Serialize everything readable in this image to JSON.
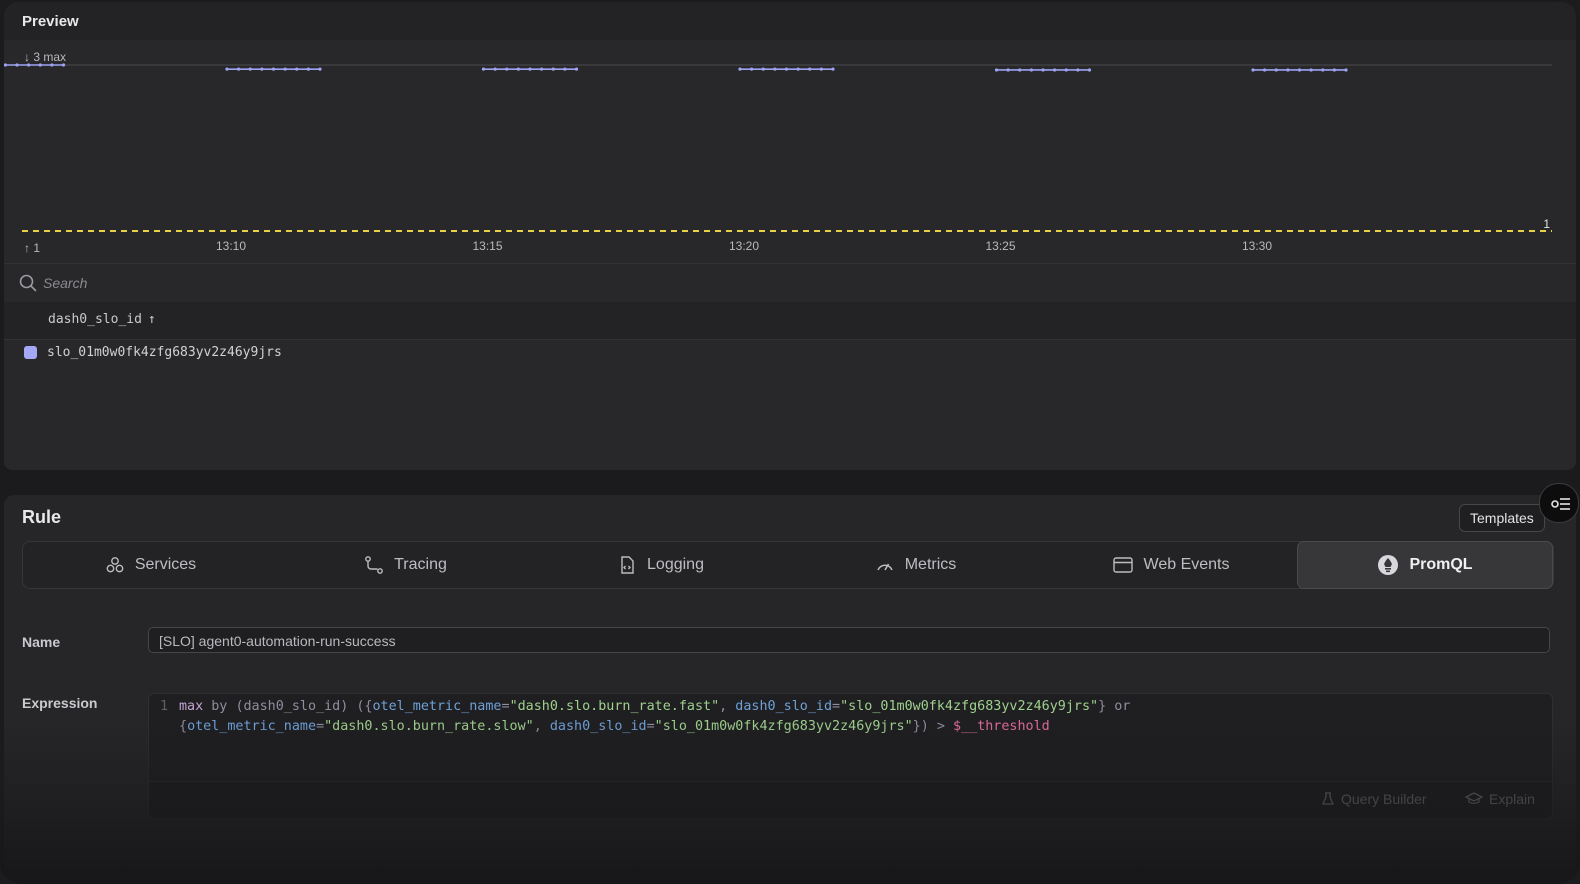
{
  "preview": {
    "title": "Preview",
    "search_placeholder": "Search",
    "table": {
      "column_header": "dash0_slo_id",
      "rows": [
        {
          "label": "slo_01m0w0fk4zfg683yv2z46y9jrs",
          "color": "#a5a8f5"
        }
      ]
    }
  },
  "chart_data": {
    "type": "line",
    "x_ticks": [
      "13:10",
      "13:15",
      "13:20",
      "13:25",
      "13:30"
    ],
    "y_max_label": "3 max",
    "y_min_label": "1",
    "threshold": {
      "value": 1,
      "label": "1",
      "color": "#e8d24a",
      "style": "dashed"
    },
    "series": [
      {
        "color": "#9ea3f2",
        "segments": [
          {
            "x": [
              "13:05",
              "13:06",
              "13:07",
              "13:08",
              "13:09",
              "13:10"
            ],
            "y": [
              3,
              3,
              3,
              3,
              3,
              3
            ]
          },
          {
            "x": [
              "13:10",
              "13:11",
              "13:12",
              "13:13",
              "13:14",
              "13:15"
            ],
            "y": [
              2.95,
              2.95,
              2.95,
              2.95,
              2.95,
              2.95
            ]
          },
          {
            "x": [
              "13:15",
              "13:16",
              "13:17",
              "13:18",
              "13:19",
              "13:20"
            ],
            "y": [
              2.95,
              2.95,
              2.95,
              2.95,
              2.95,
              2.95
            ]
          },
          {
            "x": [
              "13:20",
              "13:21",
              "13:22",
              "13:23",
              "13:24",
              "13:25"
            ],
            "y": [
              2.95,
              2.95,
              2.95,
              2.95,
              2.95,
              2.95
            ]
          },
          {
            "x": [
              "13:25",
              "13:26",
              "13:27",
              "13:28",
              "13:29",
              "13:30"
            ],
            "y": [
              2.94,
              2.94,
              2.94,
              2.94,
              2.94,
              2.94
            ]
          },
          {
            "x": [
              "13:30",
              "13:31",
              "13:32",
              "13:33",
              "13:34",
              "13:35"
            ],
            "y": [
              2.94,
              2.94,
              2.94,
              2.94,
              2.94,
              2.94
            ]
          }
        ]
      }
    ],
    "grid": false
  },
  "rule": {
    "title": "Rule",
    "templates_label": "Templates",
    "tabs": [
      {
        "label": "Services",
        "icon": "services-icon"
      },
      {
        "label": "Tracing",
        "icon": "tracing-icon"
      },
      {
        "label": "Logging",
        "icon": "logging-icon"
      },
      {
        "label": "Metrics",
        "icon": "metrics-icon"
      },
      {
        "label": "Web Events",
        "icon": "web-events-icon"
      },
      {
        "label": "PromQL",
        "icon": "promql-icon",
        "active": true
      }
    ],
    "name_label": "Name",
    "name_value": "[SLO] agent0-automation-run-success",
    "expression_label": "Expression",
    "expression": {
      "line_number": "1",
      "line1": {
        "p1": "max",
        "p2": " by ",
        "p3": "(dash0_slo_id) ({",
        "p4": "otel_metric_name",
        "p5": "=",
        "p6": "\"dash0.slo.burn_rate.fast\"",
        "p7": ", ",
        "p8": "dash0_slo_id",
        "p9": "=",
        "p10": "\"slo_01m0w0fk4zfg683yv2z46y9jrs\"",
        "p11": "} or"
      },
      "line2": {
        "p1": "{",
        "p2": "otel_metric_name",
        "p3": "=",
        "p4": "\"dash0.slo.burn_rate.slow\"",
        "p5": ", ",
        "p6": "dash0_slo_id",
        "p7": "=",
        "p8": "\"slo_01m0w0fk4zfg683yv2z46y9jrs\"",
        "p9": "}) > ",
        "p10": "$__threshold"
      }
    },
    "query_builder_label": "Query Builder",
    "explain_label": "Explain"
  }
}
